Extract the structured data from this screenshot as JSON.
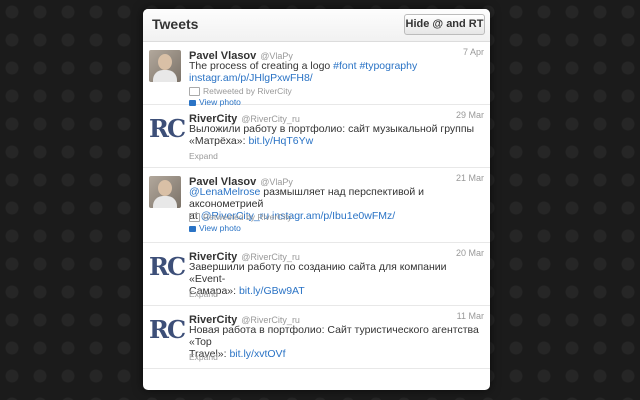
{
  "widget": {
    "title": "Tweets",
    "hide_button": "Hide @ and RT"
  },
  "tweets": [
    {
      "name": "Pavel Vlasov",
      "handle": "@VlaPy",
      "date": "7 Apr",
      "line1": "The process of creating a logo ",
      "line1_hashtags": "#font #typography",
      "line2_link": "instagr.am/p/JHlgPxwFH8/",
      "retweeted": "Retweeted by RiverCity",
      "view_photo": "View photo"
    },
    {
      "name": "RiverCity",
      "handle": "@RiverCity_ru",
      "date": "29 Mar",
      "line1": "Выложили работу в портфолио: сайт музыкальной группы",
      "line2": "«Матрёха»: ",
      "line2_link": "bit.ly/HqT6Yw",
      "expand": "Expand"
    },
    {
      "name": "Pavel Vlasov",
      "handle": "@VlaPy",
      "date": "21 Mar",
      "line1_link": "@LenaMelrose",
      "line1": " размышляет над перспективой и аксонометрией",
      "line2_prefix": "at ",
      "line2_link": "@RiverCity_ru instagr.am/p/Ibu1e0wFMz/",
      "retweeted": "Retweeted by RiverCity",
      "view_photo": "View photo"
    },
    {
      "name": "RiverCity",
      "handle": "@RiverCity_ru",
      "date": "20 Mar",
      "line1": "Завершили работу по созданию сайта для компании «Event-",
      "line2": "Самара»: ",
      "line2_link": "bit.ly/GBw9AT",
      "expand": "Expand"
    },
    {
      "name": "RiverCity",
      "handle": "@RiverCity_ru",
      "date": "11 Mar",
      "line1": "Новая работа в портфолио: Сайт туристического агентства «Top",
      "line2": "Travel»: ",
      "line2_link": "bit.ly/xvtOVf",
      "expand": "Expand"
    }
  ],
  "logo_text": "RC",
  "colors": {
    "link": "#2a73c5",
    "logo": "#3d4f78",
    "background": "#1b1b1b"
  }
}
